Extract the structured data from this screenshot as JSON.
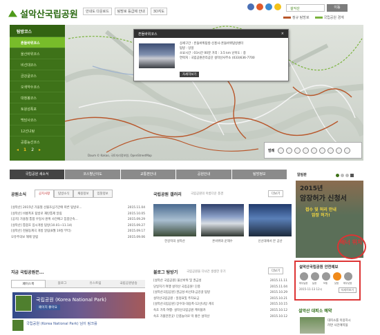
{
  "header": {
    "logo_text": "설악산국립공원",
    "links": [
      "안내도 다운로드",
      "탐방로 등급제 안내",
      "3D지도"
    ],
    "park_select": "설악산",
    "go_button": "이동",
    "legend": [
      "정규 탐방로",
      "국립공원 경계"
    ],
    "colors": {
      "brand_green": "#3e7219",
      "accent_green": "#78bc2a",
      "trail": "#b8562a",
      "boundary": "#7ab33c"
    }
  },
  "sidebar": {
    "title": "탐방코스",
    "items": [
      "흔들바위코스",
      "울산바위코스",
      "비선대코스",
      "금강굴코스",
      "오색약수코스",
      "대청봉코스",
      "토왕성폭포",
      "백담사코스",
      "12선녀탕",
      "공룡능선코스"
    ],
    "pager": {
      "prev": "◂",
      "page1": "1",
      "page2": "2",
      "next": "▸"
    }
  },
  "map": {
    "popup": {
      "title": "흔들바위코스",
      "close": "×",
      "lines": [
        "상세구간 : 흔들바위탐방-신흥사-흔들바위탐방센터",
        "탐방 : 당일",
        "소요시간 : 03시간 00분   거리 : 3.5 km   난이도 : 중",
        "연락처 : 국립공원관리공단 설악산사무소 (033)636-7700"
      ],
      "button": "자세히보기"
    },
    "legend_label": "범례",
    "copyright": "Daum © Kakao, 국토지리정보원, OpenStreetMap"
  },
  "tabs": [
    "국립공원 새소식",
    "코스별난이도",
    "교통편안내",
    "공원안내",
    "탐방정보"
  ],
  "notice": {
    "title": "공원소식",
    "tabs": [
      "공지사항",
      "탐방소식",
      "채용정보",
      "입찰정보"
    ],
    "items": [
      {
        "t": "[설악산] 2015년 가을철 산불조심기간에 따른 탐방로...",
        "d": "2015.11.04"
      },
      {
        "t": "[설악산] 비룡폭포 탐방로 재탄통제 알림",
        "d": "2015.10.05"
      },
      {
        "t": "[공지] 가을철 통합 우일사 원위 사전예고 집중단속...",
        "d": "2015.09.29"
      },
      {
        "t": "[설악산] 통합호 임시개방 탐방(10.01~11.14)",
        "d": "2015.09.27"
      },
      {
        "t": "[설악산] 천불동계곡 개방 알림(8월 19일 부터)",
        "d": "2015.09.17"
      },
      {
        "t": "오유주의보 해제 알림",
        "d": "2015.09.06"
      }
    ]
  },
  "gallery": {
    "title": "국립공원 갤러리",
    "sub": "국립공원의 아름다운 풍경",
    "more": "더보기",
    "captions": [
      "한강작의 설악산",
      "흔바위와 운해수",
      "신선대에서 본 공산"
    ]
  },
  "banner": {
    "label": "알림판",
    "year": "2015년",
    "main": "암장허가 신청서",
    "sub1": "접수 및 허리 안내",
    "sub2": "암장 허가!",
    "overlay": "배너 위치"
  },
  "safety": {
    "title": "설악산국립공원 안전예보",
    "levels": [
      "매우높음",
      "높음",
      "보통",
      "낮음",
      "매우낮음"
    ],
    "date": "2015-11-13 12시",
    "button": "자세히보기"
  },
  "blog": {
    "title": "블로그 탐방기",
    "sub": "국립공원을 다녀간 생생한 후기",
    "more": "더보기",
    "items": [
      {
        "t": "[설악산 국립공원] 울산바위 및 권금성",
        "d": "2015.11.11"
      },
      {
        "t": "당일치기 여행 설악산 국립공원! 단풍",
        "d": "2015.11.04"
      },
      {
        "t": "[설악산국립공원] 권금성-비선대-금강굴 탐방",
        "d": "2015.10.29"
      },
      {
        "t": "설악산국립공원 : 일정표및 주차요금",
        "d": "2015.10.21"
      },
      {
        "t": "[설악산국립공원] 장수대-대승폭-12선녀탕 계곡",
        "d": "2015.10.15"
      },
      {
        "t": "속초 가족 여행- 설악산국립공원 케이블카",
        "d": "2015.10.12"
      },
      {
        "t": "속초 가볼만한곳! 단풍놀이로 딱 좋은 설악산",
        "d": "2015.10.12"
      }
    ]
  },
  "now": {
    "title": "지금 국립공원은...",
    "tabs": [
      "페이스북",
      "블로그",
      "유스트림",
      "국립공원방송"
    ],
    "fb_name": "국립공원 (Korea National Park)",
    "fb_like": "페이지 좋아요",
    "fb_name2": "국립공원 (Korea National Park) 님이 링크를"
  },
  "reserve": {
    "title": "설악산 대피소 예약",
    "text1": "대피소를 이용하시",
    "text2": "려면 사전예약을"
  }
}
